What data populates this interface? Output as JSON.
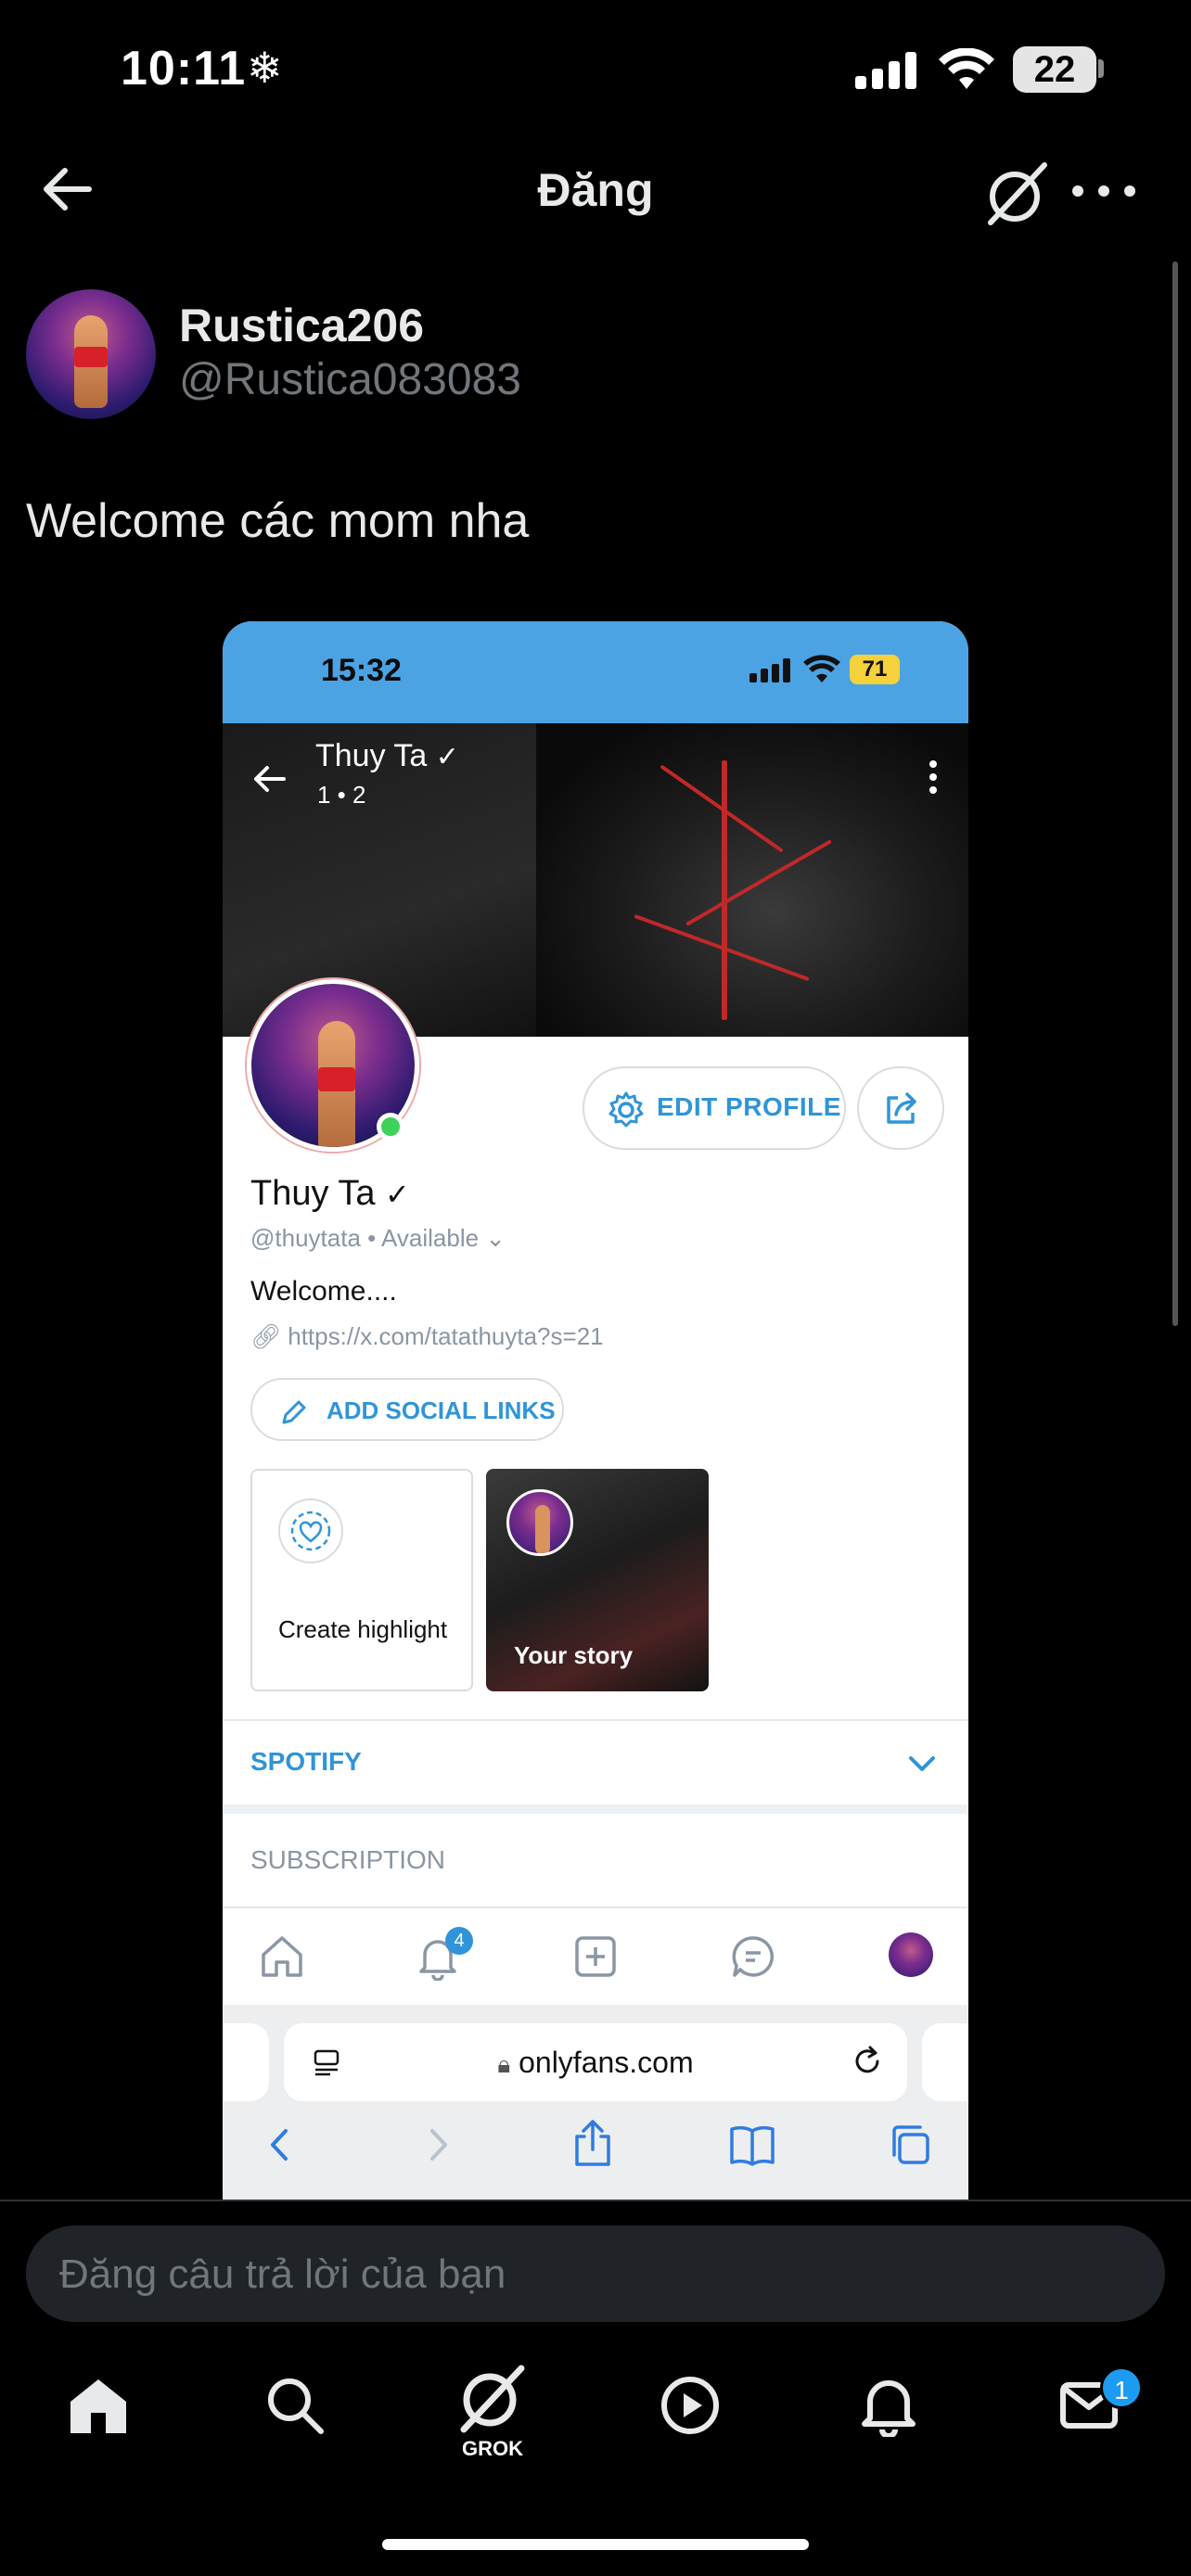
{
  "status_bar": {
    "time": "10:11",
    "battery": "22"
  },
  "header": {
    "title": "Đăng"
  },
  "post": {
    "display_name": "Rustica206",
    "handle": "@Rustica083083",
    "text": "Welcome các mom nha"
  },
  "embedded_screenshot": {
    "status_time": "15:32",
    "battery": "71",
    "cover": {
      "name": "Thuy Ta",
      "meta": "1  •  2"
    },
    "edit_profile_label": "EDIT PROFILE",
    "profile_name": "Thuy Ta",
    "profile_handle": "@thuytata  •  Available",
    "bio": "Welcome....",
    "link": "https://x.com/tatathuyta?s=21",
    "add_social_label": "ADD SOCIAL LINKS",
    "create_highlight_label": "Create highlight",
    "your_story_label": "Your story",
    "spotify_label": "SPOTIFY",
    "subscription_label": "SUBSCRIPTION",
    "notifications_badge": "4",
    "url": "onlyfans.com"
  },
  "reply": {
    "placeholder": "Đăng câu trả lời của bạn"
  },
  "tab_bar": {
    "grok_label": "GROK",
    "messages_badge": "1"
  }
}
